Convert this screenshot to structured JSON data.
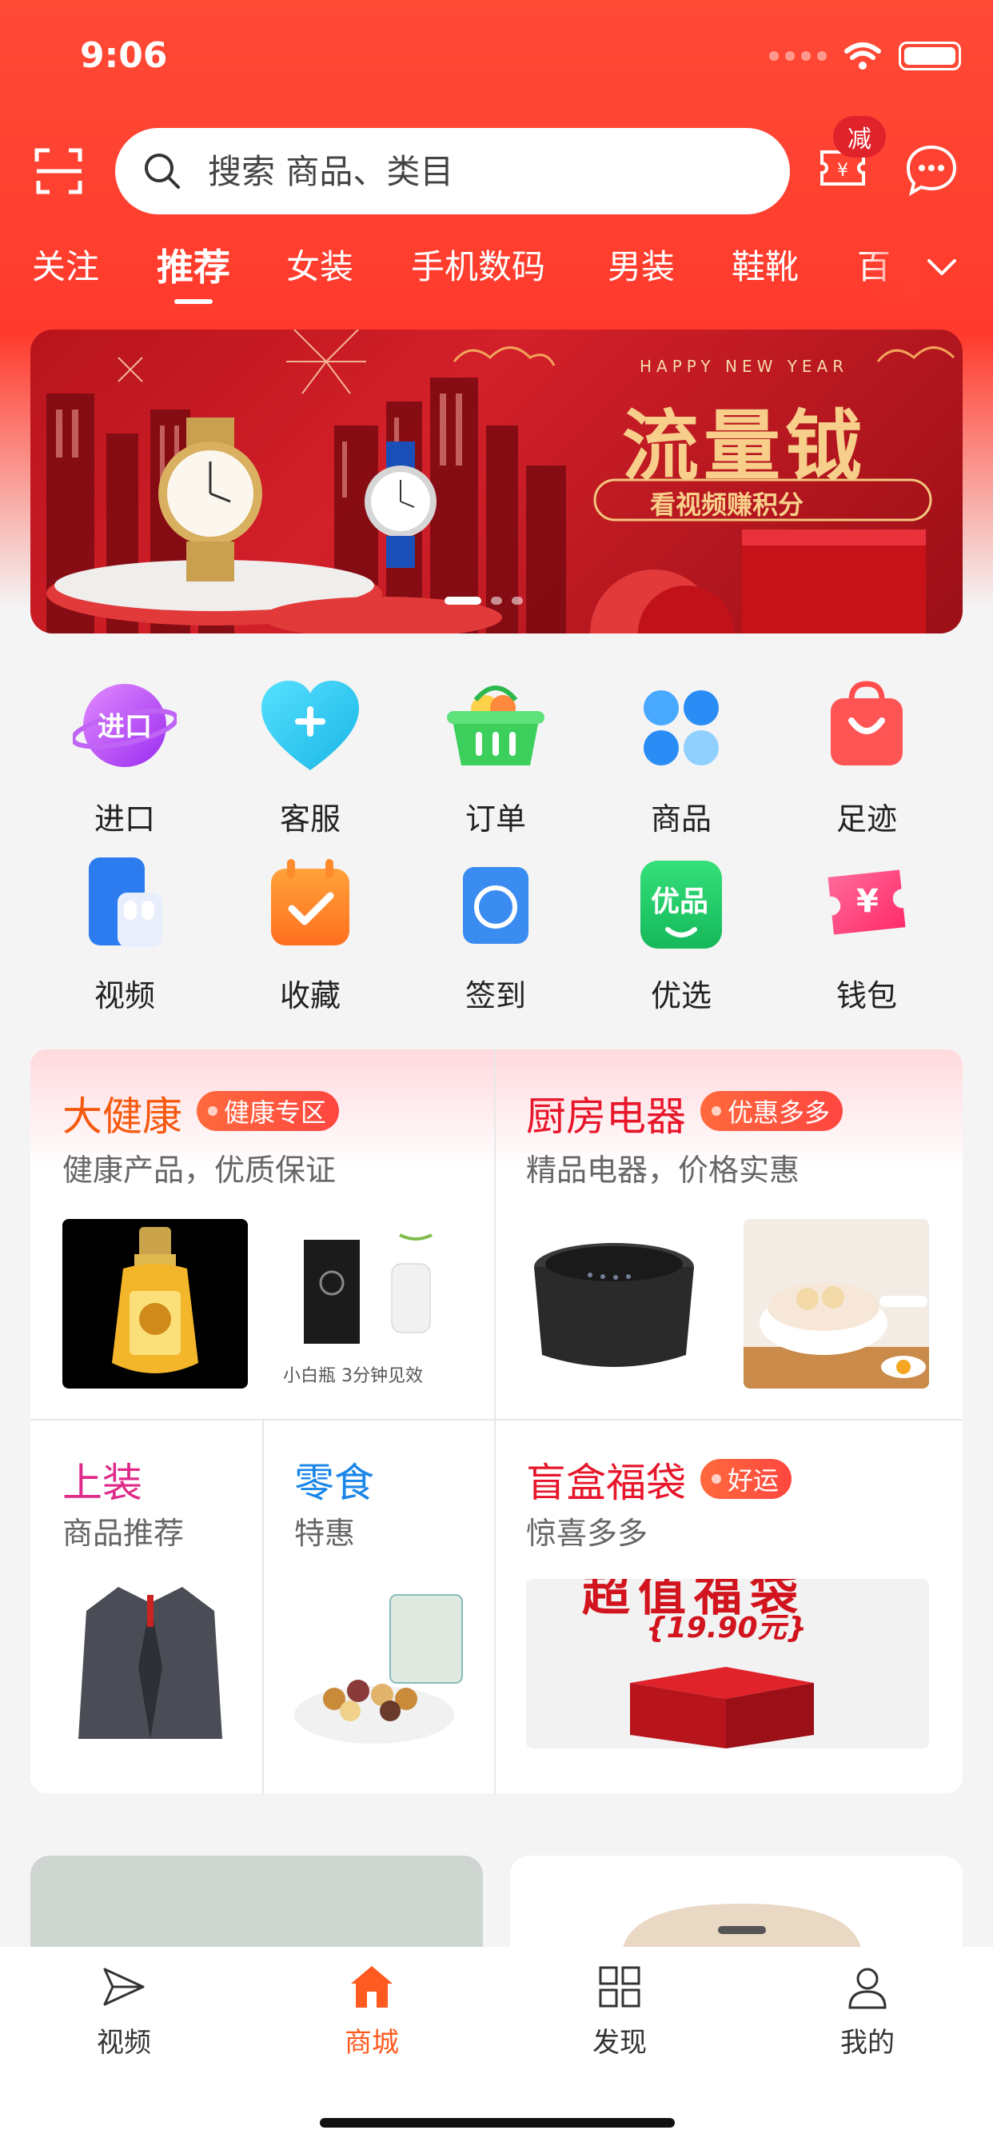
{
  "status_bar": {
    "time": "9:06"
  },
  "search": {
    "placeholder": "搜索 商品、类目"
  },
  "coupon_badge": "减",
  "category_tabs": [
    "关注",
    "推荐",
    "女装",
    "手机数码",
    "男装",
    "鞋靴",
    "百"
  ],
  "banner": {
    "eyebrow": "HAPPY NEW YEAR",
    "title": "流量钺",
    "subtitle": "看视频赚积分"
  },
  "quick_grid": [
    {
      "label": "进口",
      "icon": "import-icon",
      "icon_text": "进口"
    },
    {
      "label": "客服",
      "icon": "customer-service-heart-icon"
    },
    {
      "label": "订单",
      "icon": "basket-icon"
    },
    {
      "label": "商品",
      "icon": "grid-icon"
    },
    {
      "label": "足迹",
      "icon": "shopping-bag-icon"
    },
    {
      "label": "视频",
      "icon": "phone-video-icon"
    },
    {
      "label": "收藏",
      "icon": "calendar-check-icon"
    },
    {
      "label": "签到",
      "icon": "camera-icon"
    },
    {
      "label": "优选",
      "icon": "youxuan-icon",
      "icon_text": "优品"
    },
    {
      "label": "钱包",
      "icon": "wallet-icon",
      "icon_text": "¥"
    }
  ],
  "promo": {
    "health": {
      "title": "大健康",
      "tag": "健康专区",
      "subtitle": "健康产品，优质保证",
      "title_color": "#f55a10"
    },
    "kitchen": {
      "title": "厨房电器",
      "tag": "优惠多多",
      "subtitle": "精品电器，价格实惠",
      "title_color": "#e8162a"
    },
    "tops": {
      "title": "上装",
      "subtitle": "商品推荐",
      "title_color": "#e02a8a"
    },
    "snacks": {
      "title": "零食",
      "subtitle": "特惠",
      "title_color": "#1a86e8"
    },
    "blindbox": {
      "title": "盲盒福袋",
      "tag": "好运",
      "subtitle": "惊喜多多",
      "title_color": "#e8162a",
      "price_text": "{19.90元}",
      "headline_text": "超值福袋"
    },
    "product_texts": {
      "health_product_caption": "小白瓶 3分钟见效"
    }
  },
  "tabbar": [
    {
      "label": "视频",
      "icon": "paper-plane-icon",
      "active": false
    },
    {
      "label": "商城",
      "icon": "home-icon",
      "active": true
    },
    {
      "label": "发现",
      "icon": "grid-icon",
      "active": false
    },
    {
      "label": "我的",
      "icon": "user-icon",
      "active": false
    }
  ],
  "colors": {
    "brand_red": "#ff3a2c",
    "active_tab": "#ff5a1f"
  }
}
